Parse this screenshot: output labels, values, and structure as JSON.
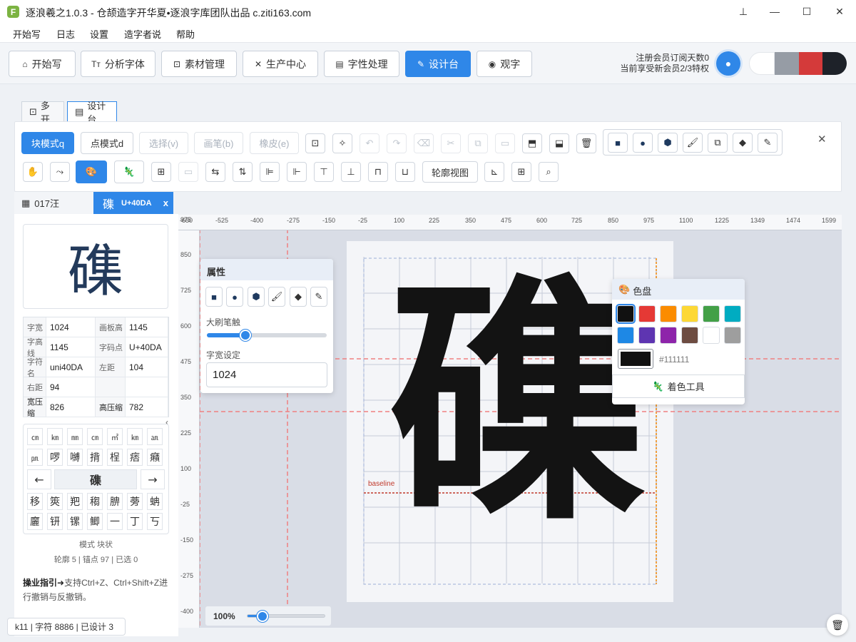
{
  "window": {
    "logo_letter": "F",
    "title": "逐浪羲之1.0.3 - 仓颉造字开华夏•逐浪字库团队出品 c.ziti163.com",
    "pin_icon": "⊥",
    "minimize_icon": "—",
    "maximize_icon": "☐",
    "close_icon": "✕"
  },
  "menu": [
    "开始写",
    "日志",
    "设置",
    "造字者说",
    "帮助"
  ],
  "nav": {
    "buttons": [
      {
        "icon": "⌂",
        "label": "开始写"
      },
      {
        "icon": "Tт",
        "label": "分析字体"
      },
      {
        "icon": "⊡",
        "label": "素材管理"
      },
      {
        "icon": "✕",
        "label": "生产中心"
      },
      {
        "icon": "▤",
        "label": "字性处理"
      },
      {
        "icon": "✎",
        "label": "设计台"
      },
      {
        "icon": "◉",
        "label": "观字"
      }
    ],
    "member_line1": "注册会员订阅天数0",
    "member_line2": "当前享受新会员2/3特权",
    "theme_swatches": [
      "#ffffff",
      "#969ca5",
      "#d43a3a",
      "#1e2229"
    ]
  },
  "doc_tabs": [
    {
      "icon": "⊡",
      "label": "多开"
    },
    {
      "icon": "▤",
      "label": "设计台"
    }
  ],
  "toolbar": {
    "modes": [
      "块模式q",
      "点模式d",
      "选择(v)",
      "画笔(b)",
      "橡皮(e)"
    ],
    "row1_icons": [
      "save",
      "sparkle",
      "undo",
      "redo",
      "eraser",
      "cut",
      "copy",
      "paste",
      "import",
      "export",
      "delete"
    ],
    "row1_glyphs": [
      "⊡",
      "✧",
      "↶",
      "↷",
      "⌫",
      "✂",
      "⧉",
      "▭",
      "⬒",
      "⬓",
      "🗑"
    ],
    "shapes": [
      "■",
      "●",
      "⬢",
      "🖌",
      "⧉",
      "◆",
      "✎"
    ],
    "row2_glyphs": [
      "✋",
      "⤳",
      "🎨",
      "🦎",
      "⊞",
      "▭",
      "⇆",
      "⇅",
      "⊫",
      "⊩",
      "⊤",
      "⊥",
      "⊓",
      "⊔"
    ],
    "outline_view": "轮廓视图",
    "row2_tail": [
      "⊾",
      "⊞",
      "⌕"
    ],
    "close": "✕"
  },
  "glyph_tabs": {
    "list_label": "017汪",
    "current_char": "磼",
    "current_code": "U+40DA",
    "close": "x"
  },
  "preview_char": "磼",
  "properties": [
    [
      "字宽",
      "1024",
      "画板高",
      "1145"
    ],
    [
      "字高线",
      "1145",
      "字码点",
      "U+40DA"
    ],
    [
      "字符名",
      "uni40DA",
      "左距",
      "104"
    ],
    [
      "右距",
      "94",
      "",
      ""
    ],
    [
      "宽压缩",
      "826",
      "高压缩",
      "782"
    ]
  ],
  "char_rows": [
    [
      "㎝",
      "㎞",
      "㎜",
      "㎝",
      "㎡",
      "㎞",
      "㏂"
    ],
    [
      "㏘",
      "啰",
      "嚩",
      "揹",
      "桯",
      "痞",
      "癪"
    ]
  ],
  "char_nav": {
    "prev": "←",
    "current": "磼",
    "next": "→"
  },
  "char_rows2": [
    [
      "移",
      "筴",
      "羓",
      "䅳",
      "腗",
      "蒡",
      "蚺"
    ],
    [
      "廲",
      "钘",
      "镙",
      "鲫",
      "一",
      "丁",
      "丂"
    ]
  ],
  "mode_label": "模式 块状",
  "stats_label": "轮廓 5 | 锚点 97 | 已选 0",
  "tip_bold": "操业指引➜",
  "tip_text": "支持Ctrl+Z、Ctrl+Shift+Z进行撤销与反撤销。",
  "ruler_top": [
    "-650",
    "-525",
    "-400",
    "-275",
    "-150",
    "-25",
    "100",
    "225",
    "350",
    "475",
    "600",
    "725",
    "850",
    "975",
    "1100",
    "1225",
    "1349",
    "1474",
    "1599"
  ],
  "ruler_left": [
    "975",
    "850",
    "725",
    "600",
    "475",
    "350",
    "225",
    "100",
    "-25",
    "-150",
    "-275",
    "-400"
  ],
  "canvas_char": "磼",
  "baseline_label": "baseline",
  "attr_panel": {
    "title": "属性",
    "brush_label": "大刷笔触",
    "brush_value": 0.32,
    "width_label": "字宽设定",
    "width_value": "1024"
  },
  "color_panel": {
    "title": "色盘",
    "colors": [
      "#111111",
      "#e53935",
      "#fb8c00",
      "#fdd835",
      "#43a047",
      "#00acc1",
      "#1e88e5",
      "#5e35b1",
      "#8e24aa",
      "#6d4c41",
      "#ffffff",
      "#9e9e9e"
    ],
    "current_color": "#111111",
    "current_hex": "#111111",
    "tool_label": "着色工具"
  },
  "zoom": {
    "label": "100%",
    "value": 0.2
  },
  "status": "k11 | 字符 8886 | 已设计 3",
  "colors": {
    "accent": "#2f87e8",
    "guide_red": "#f08080",
    "guide_orange": "#f0a040"
  }
}
